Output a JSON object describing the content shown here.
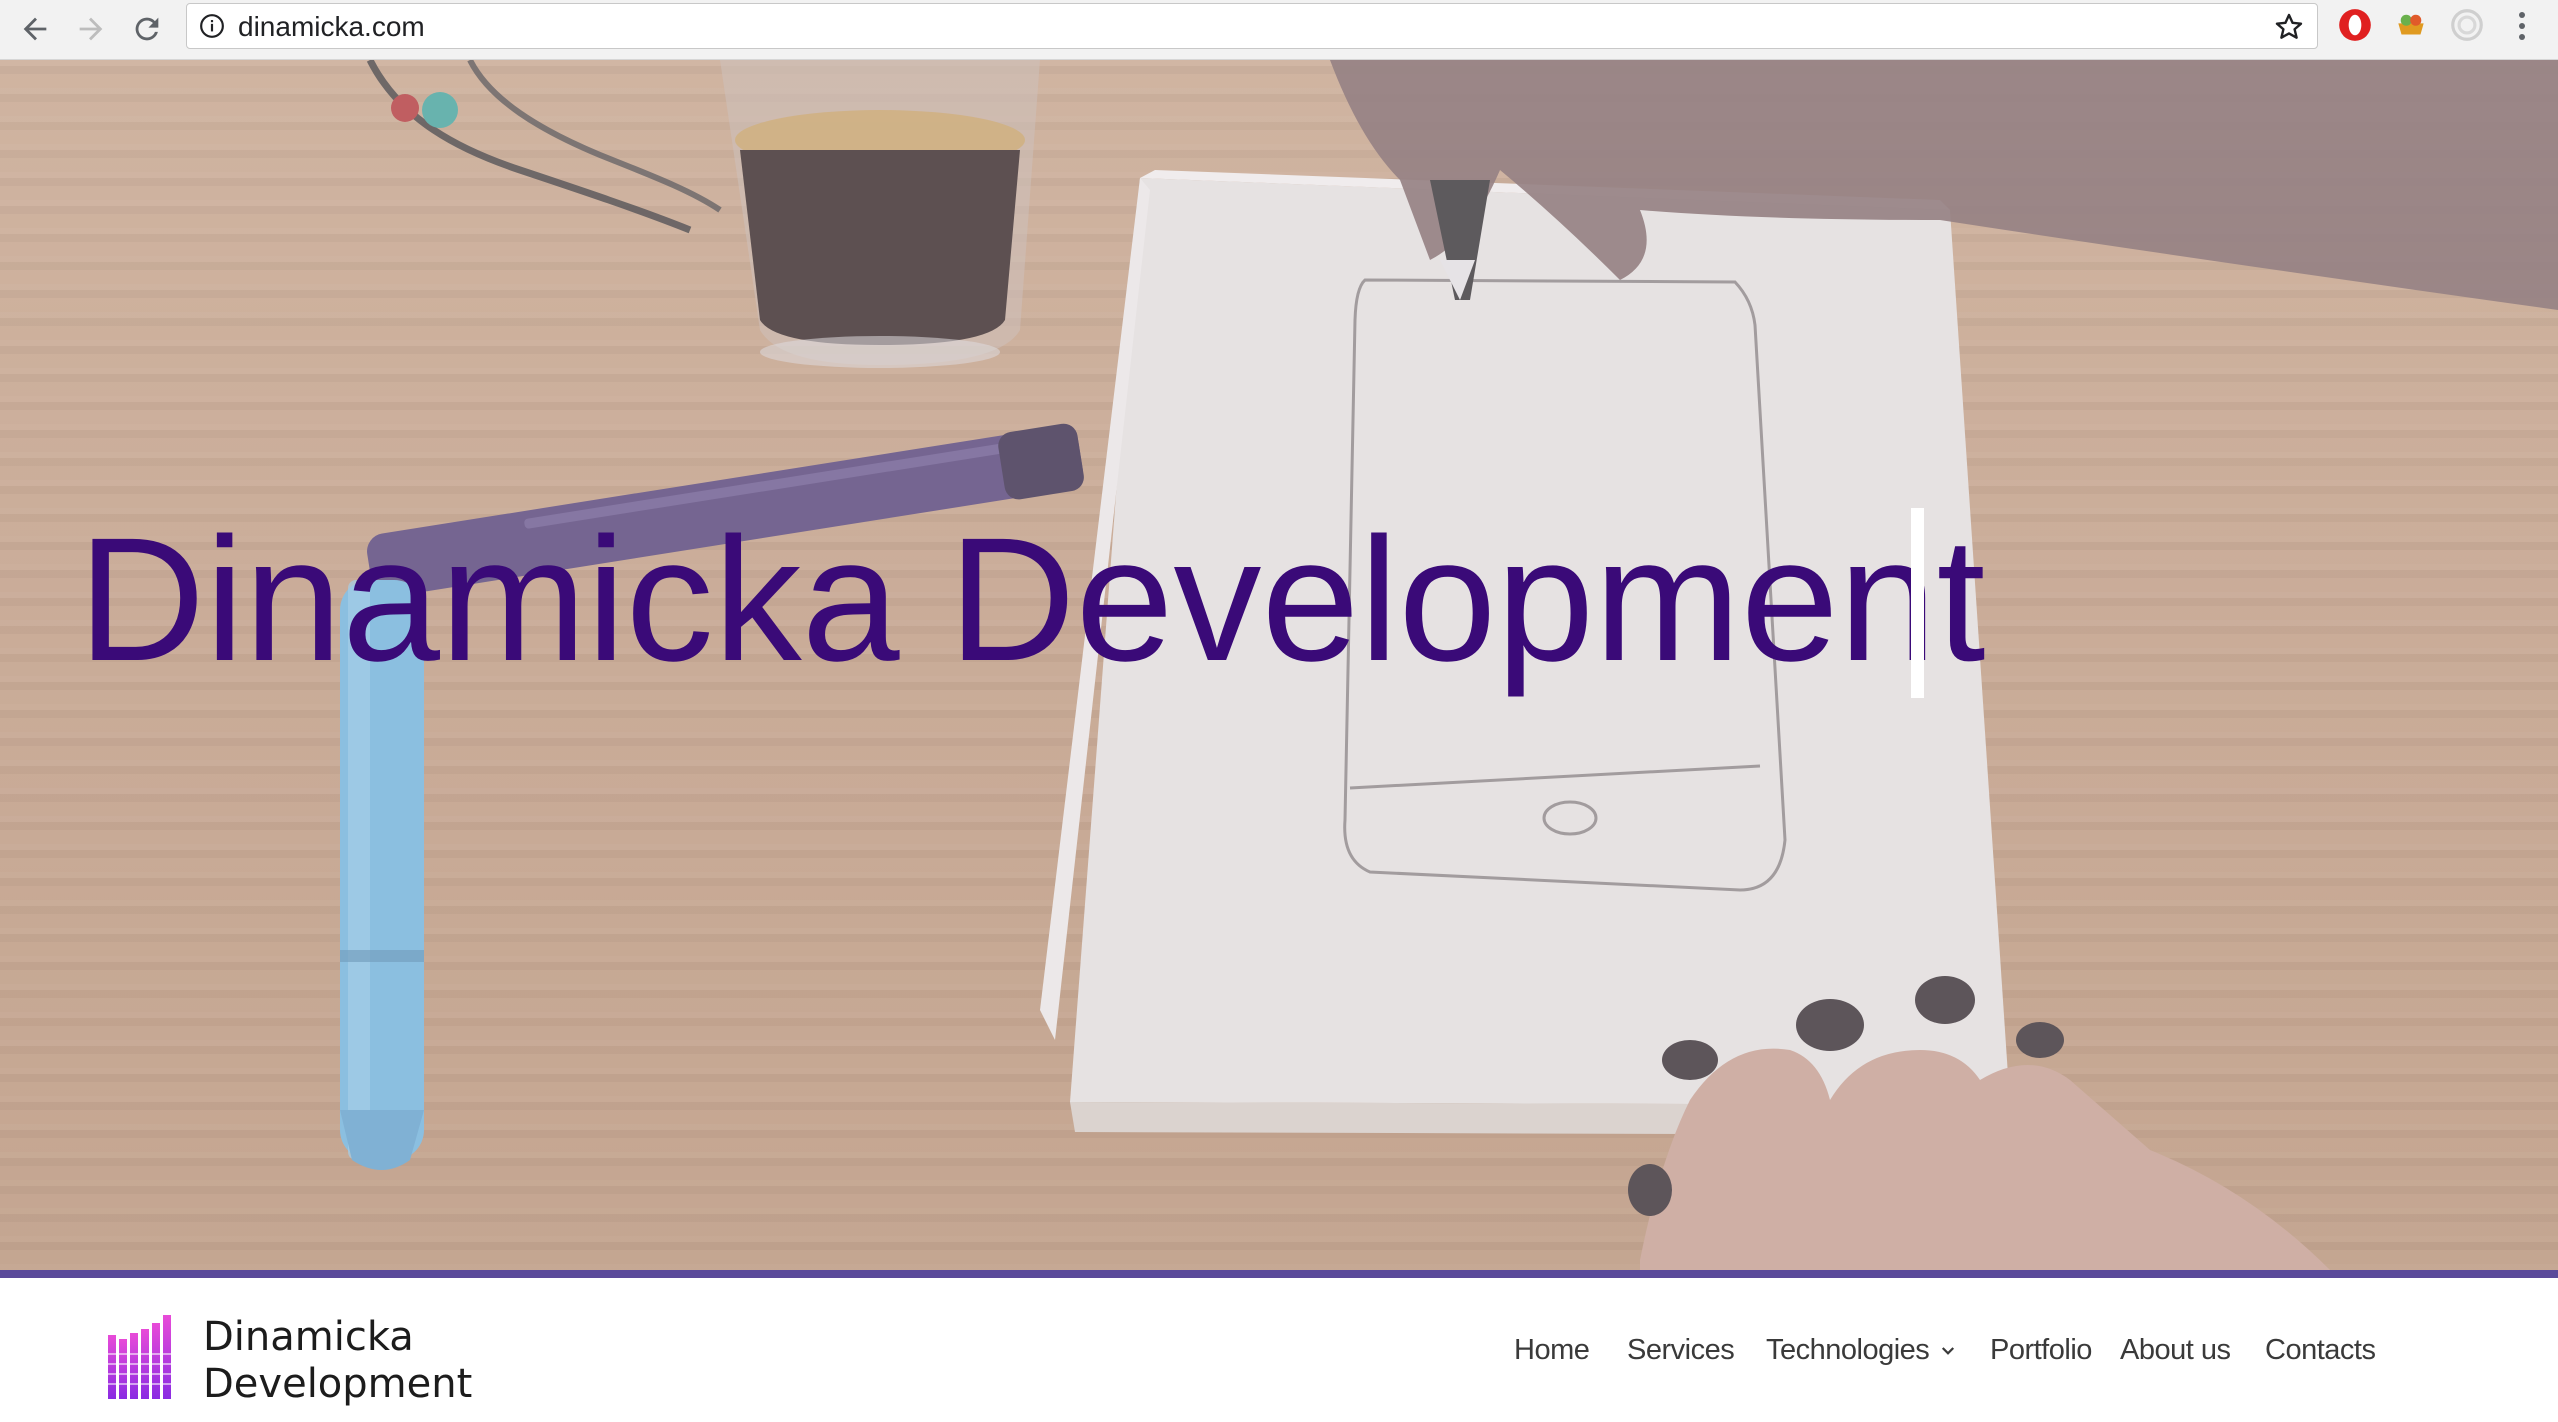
{
  "browser": {
    "url": "dinamicka.com",
    "icons": {
      "back": "back-arrow-icon",
      "forward": "forward-arrow-icon",
      "reload": "reload-icon",
      "info": "info-icon",
      "bookmark": "star-icon",
      "ext1": "opera-extension-icon",
      "ext2": "fruit-extension-icon",
      "ext3": "target-extension-icon",
      "menu": "more-vertical-icon"
    }
  },
  "hero": {
    "title": "Dinamicka Development",
    "title_color": "#3a0a78"
  },
  "header": {
    "logo_line1": "Dinamicka",
    "logo_line2": "Development",
    "accent_color": "#5b4a9a",
    "nav": [
      {
        "label": "Home"
      },
      {
        "label": "Services"
      },
      {
        "label": "Technologies"
      },
      {
        "label": "Portfolio"
      },
      {
        "label": "About us"
      },
      {
        "label": "Contacts"
      }
    ]
  }
}
